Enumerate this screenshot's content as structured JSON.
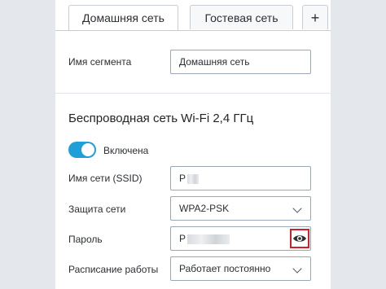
{
  "tabs": [
    {
      "label": "Домашняя сеть",
      "active": true
    },
    {
      "label": "Гостевая сеть",
      "active": false
    },
    {
      "label": "+",
      "active": false
    }
  ],
  "segment": {
    "label": "Имя сегмента",
    "value": "Домашняя сеть"
  },
  "wifi": {
    "title": "Беспроводная сеть Wi-Fi 2,4 ГГц",
    "toggle_label": "Включена",
    "toggle_on": true,
    "ssid_label": "Имя сети (SSID)",
    "ssid_value": "P",
    "security_label": "Защита сети",
    "security_value": "WPA2-PSK",
    "password_label": "Пароль",
    "password_value": "P",
    "schedule_label": "Расписание работы",
    "schedule_value": "Работает постоянно"
  },
  "icons": {
    "show_password": "eye-icon",
    "dropdown": "chevron-down-icon"
  },
  "colors": {
    "accent": "#1f9fd8",
    "highlight": "#d0202a"
  }
}
